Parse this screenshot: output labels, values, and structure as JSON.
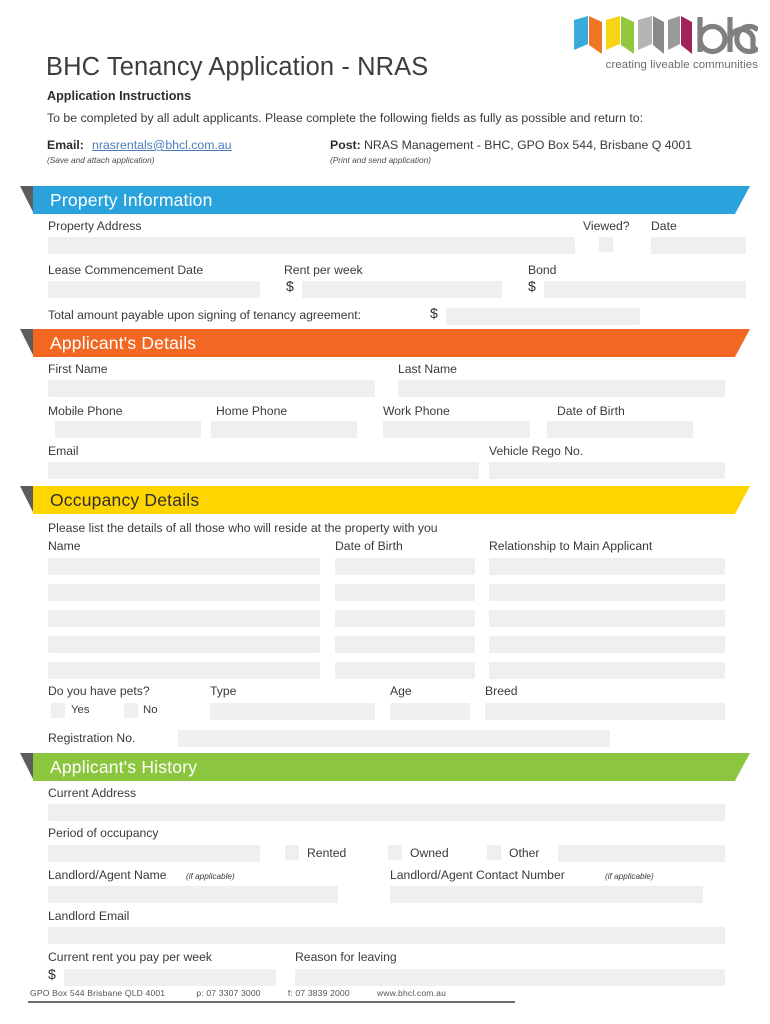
{
  "document": {
    "title": "BHC Tenancy Application - NRAS",
    "instructions_heading": "Application Instructions",
    "instructions_body": "To be completed by all adult applicants. Please complete the following fields as fully as possible and return to:",
    "email_label": "Email:",
    "email_address": "nrasrentals@bhcl.com.au",
    "email_note": "(Save and attach application)",
    "post_label": "Post:",
    "post_address": "NRAS Management - BHC, GPO Box 544, Brisbane Q 4001",
    "post_note": "(Print and send application)"
  },
  "logo": {
    "wordmark": "bhc",
    "tagline": "creating liveable communities",
    "bar_colors": [
      "#3aa9dc",
      "#ef7622",
      "#f7d417",
      "#93c83e",
      "#9b9b9b",
      "#a0235c"
    ],
    "wordmark_color": "#808080"
  },
  "colors": {
    "property": "#2aa3dc",
    "applicant": "#f26722",
    "occupancy": "#ffd500",
    "history": "#8cc63e",
    "field": "#efefef",
    "notch": "#5d5d5d",
    "link": "#4a7ebb"
  },
  "sections": {
    "property": {
      "title": "Property Information",
      "property_address_label": "Property Address",
      "viewed_label": "Viewed?",
      "date_label": "Date",
      "lease_commencement_label": "Lease Commencement Date",
      "rent_per_week_label": "Rent per week",
      "bond_label": "Bond",
      "total_payable_label": "Total amount payable upon signing of tenancy agreement:",
      "currency": "$",
      "values": {
        "property_address": "",
        "viewed": "",
        "date": "",
        "lease_commencement": "",
        "rent_per_week": "",
        "bond": "",
        "total_payable": ""
      }
    },
    "applicant": {
      "title": "Applicant's Details",
      "first_name_label": "First Name",
      "last_name_label": "Last Name",
      "mobile_phone_label": "Mobile Phone",
      "home_phone_label": "Home Phone",
      "work_phone_label": "Work Phone",
      "date_of_birth_label": "Date of Birth",
      "email_label": "Email",
      "vehicle_rego_label": "Vehicle Rego No.",
      "values": {
        "first_name": "",
        "last_name": "",
        "mobile_phone": "",
        "home_phone": "",
        "work_phone": "",
        "date_of_birth": "",
        "email": "",
        "vehicle_rego": ""
      }
    },
    "occupancy": {
      "title": "Occupancy Details",
      "intro": "Please list the details of all those who will reside at the property with you",
      "columns": [
        "Name",
        "Date of Birth",
        "Relationship to Main Applicant"
      ],
      "rows": [
        {
          "name": "",
          "date_of_birth": "",
          "relationship": ""
        },
        {
          "name": "",
          "date_of_birth": "",
          "relationship": ""
        },
        {
          "name": "",
          "date_of_birth": "",
          "relationship": ""
        },
        {
          "name": "",
          "date_of_birth": "",
          "relationship": ""
        },
        {
          "name": "",
          "date_of_birth": "",
          "relationship": ""
        }
      ],
      "pets_question": "Do you have pets?",
      "pets_yes_label": "Yes",
      "pets_no_label": "No",
      "type_label": "Type",
      "age_label": "Age",
      "breed_label": "Breed",
      "registration_label": "Registration No.",
      "values": {
        "pets_yes": "",
        "pets_no": "",
        "type": "",
        "age": "",
        "breed": "",
        "registration_no": ""
      }
    },
    "history": {
      "title": "Applicant's History",
      "current_address_label": "Current Address",
      "period_of_occupancy_label": "Period of occupancy",
      "rented_label": "Rented",
      "owned_label": "Owned",
      "other_label": "Other",
      "landlord_name_label": "Landlord/Agent Name",
      "landlord_name_note": "(if applicable)",
      "landlord_contact_label": "Landlord/Agent Contact Number",
      "landlord_contact_note": "(if applicable)",
      "landlord_email_label": "Landlord Email",
      "current_rent_label": "Current rent you pay per week",
      "reason_for_leaving_label": "Reason for leaving",
      "currency": "$",
      "values": {
        "current_address": "",
        "period_of_occupancy": "",
        "rented": "",
        "owned": "",
        "other": "",
        "other_detail": "",
        "landlord_name": "",
        "landlord_contact": "",
        "landlord_email": "",
        "current_rent": "",
        "reason_for_leaving": ""
      }
    }
  },
  "footer": {
    "address": "GPO Box 544 Brisbane QLD 4001",
    "phone": "p: 07 3307 3000",
    "fax": "f: 07 3839 2000",
    "website": "www.bhcl.com.au"
  }
}
